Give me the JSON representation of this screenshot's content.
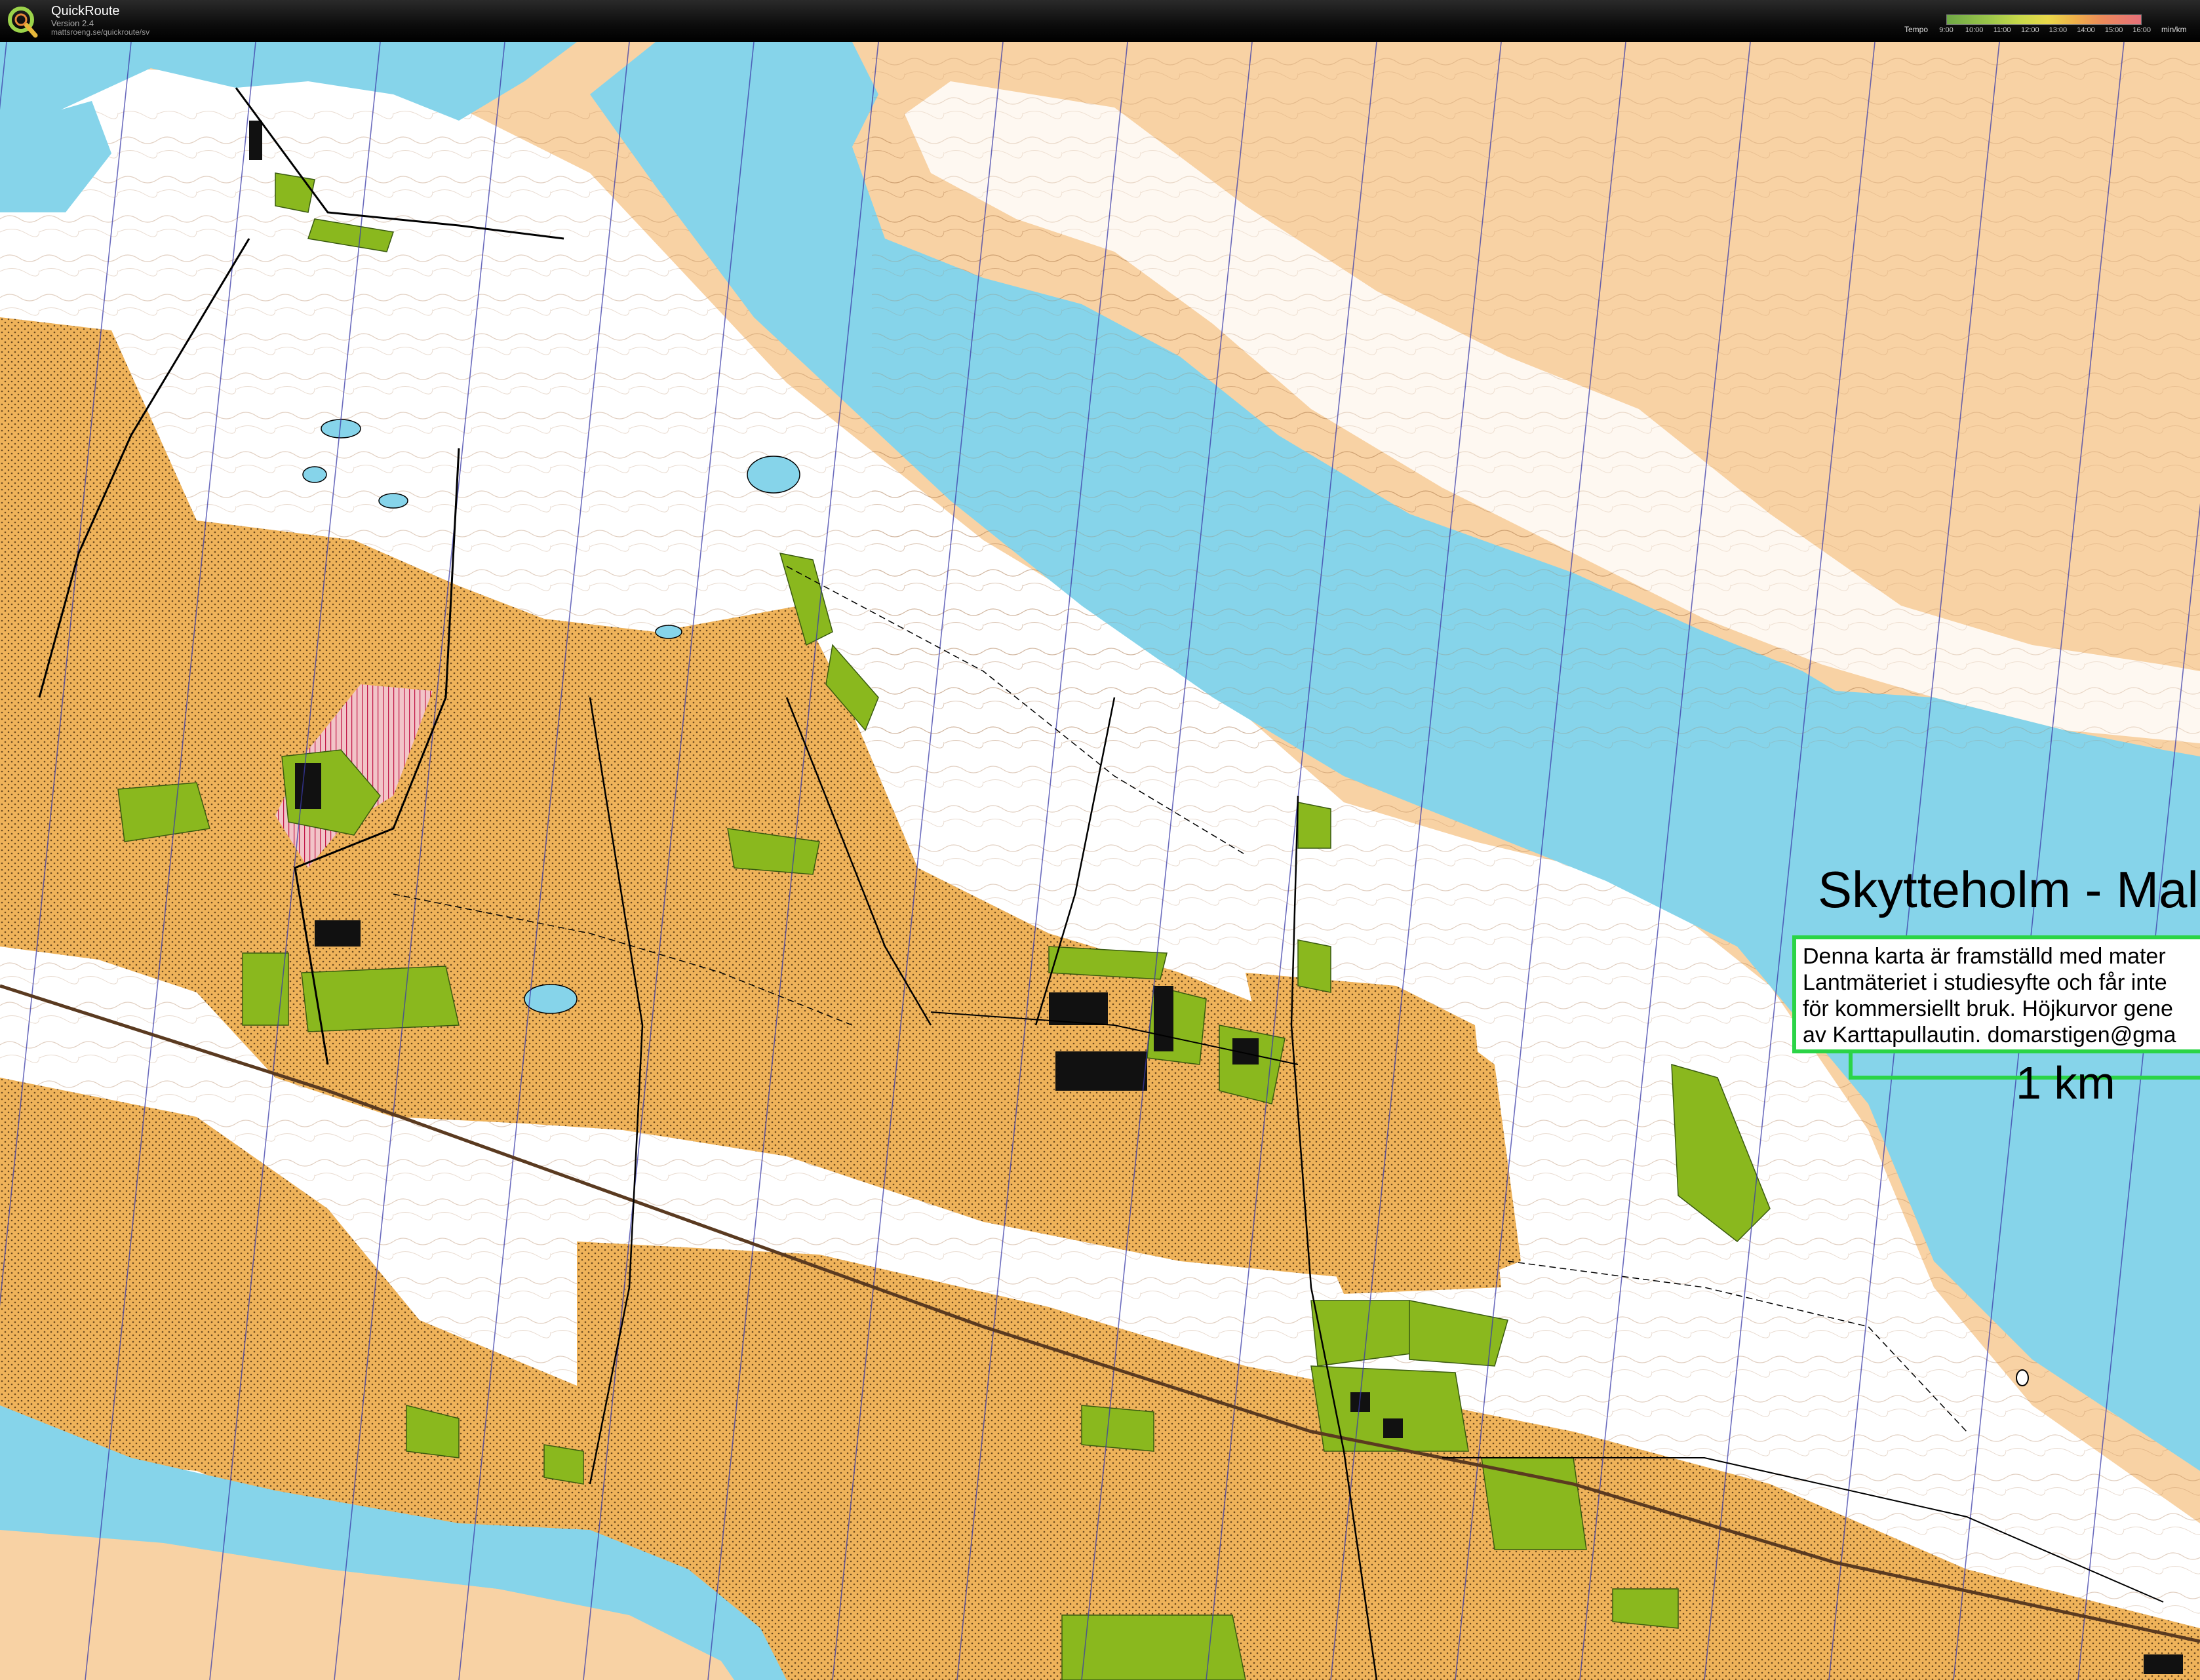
{
  "window": {
    "title": "QuickRoute",
    "version": "Version 2.4",
    "url": "mattsroeng.se/quickroute/sv"
  },
  "legend": {
    "label": "Tempo",
    "ticks": [
      "9:00",
      "10:00",
      "11:00",
      "12:00",
      "13:00",
      "14:00",
      "15:00",
      "16:00"
    ],
    "unit": "min/km"
  },
  "map": {
    "title": "Skytteholm - Maln",
    "info_lines": [
      "Denna karta är framställd med mater",
      "Lantmäteriet i studiesyfte och får inte",
      "för kommersiellt bruk. Höjkurvor gene",
      "av Karttapullautin. domarstigen@gma"
    ],
    "scale_label": "1 km"
  },
  "colors": {
    "water": "#86d4ea",
    "open_land": "#f8d2a4",
    "rough_open": "#f0b658",
    "forest": "#ffffff",
    "vegetation": "#8ab81e",
    "buildings": "#111111",
    "info_border": "#2bd447"
  }
}
